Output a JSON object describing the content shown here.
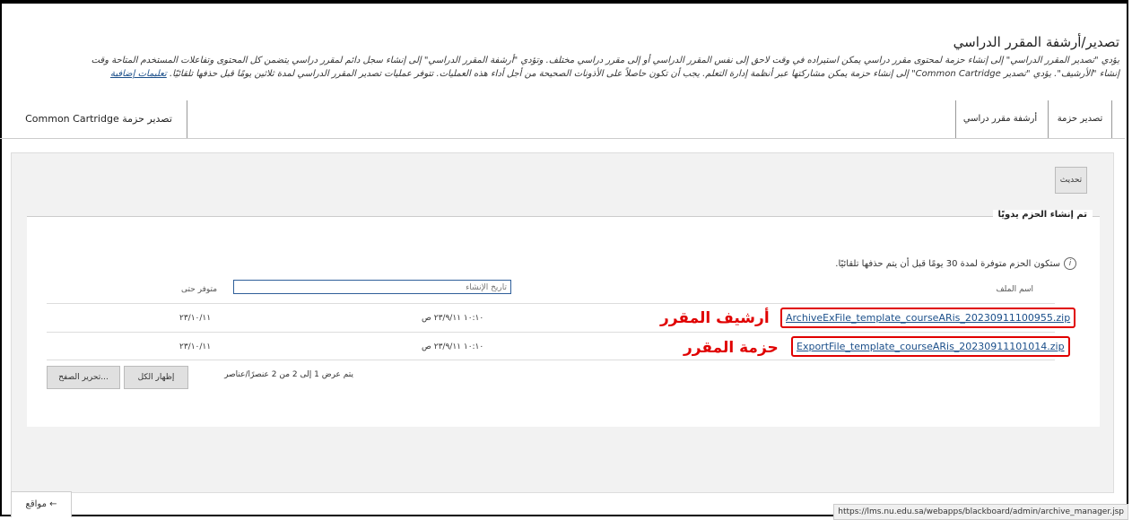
{
  "page": {
    "title": "تصدير/أرشفة المقرر الدراسي",
    "description_line1": "يؤدي \"تصدير المقرر الدراسي\" إلى إنشاء حزمة لمحتوى مقرر دراسي يمكن استيراده في وقت لاحق إلى نفس المقرر الدراسي أو إلى مقرر دراسي مختلف. وتؤدي \"أرشفة المقرر الدراسي\" إلى إنشاء سجل دائم لمقرر دراسي يتضمن كل المحتوى وتفاعلات المستخدم المتاحة وقت",
    "description_line2": "إنشاء \"الأرشيف\". يؤدي \"تصدير Common Cartridge\" إلى إنشاء حزمة يمكن مشاركتها عبر أنظمة إدارة التعلم. يجب أن تكون حاصلاً على الأذونات الصحيحة من أجل أداء هذه العمليات. تتوفر عمليات تصدير المقرر الدراسي لمدة ثلاثين يومًا قبل حذفها تلقائيًا.",
    "more_help": "تعليمات إضافية"
  },
  "tabs": {
    "export": "تصدير حزمة",
    "archive": "أرشفة مقرر دراسي",
    "common_cartridge": "تصدير حزمة Common Cartridge"
  },
  "panel": {
    "refresh_label": "تحديث",
    "section_title": "تم إنشاء الحزم يدويًا",
    "info_text": "ستكون الحزم متوفرة لمدة 30 يومًا قبل أن يتم حذفها تلقائيًا.",
    "columns": {
      "file_name": "اسم الملف",
      "created_placeholder": "تاريخ الإنشاء",
      "available_until": "متوفر حتى"
    },
    "rows": [
      {
        "file": "ArchiveExFile_template_courseARis_20230911100955.zip",
        "created": "١٠:١٠ ٢٣/٩/١١ ص",
        "available": "٢٣/١٠/١١",
        "annotation": "أرشيف المقرر"
      },
      {
        "file": "ExportFile_template_courseARis_20230911101014.zip",
        "created": "١٠:١٠ ٢٣/٩/١١ ص",
        "available": "٢٣/١٠/١١",
        "annotation": "حزمة المقرر"
      }
    ],
    "pager_text": "يتم عرض 1 إلى 2 من 2 عنصرًا/عناصر",
    "show_all_label": "إظهار الكل",
    "edit_paging_label": "تحرير الصفح..."
  },
  "footer": {
    "back_label": "← مواقع",
    "status_url": "https://lms.nu.edu.sa/webapps/blackboard/admin/archive_manager.jsp"
  },
  "colors": {
    "annotation_red": "#e00000",
    "link_blue": "#1b4f8a"
  }
}
